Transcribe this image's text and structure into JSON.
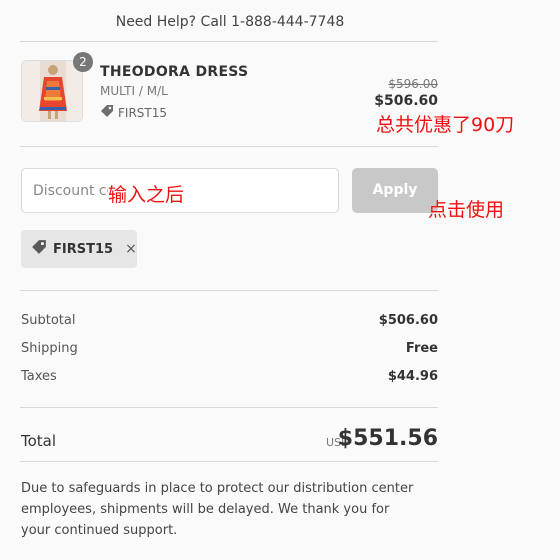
{
  "header": {
    "help_text": "Need Help? Call 1-888-444-7748"
  },
  "item": {
    "quantity": "2",
    "name": "THEODORA DRESS",
    "variant": "MULTI / M/L",
    "discount_code": "FIRST15",
    "original_price": "$596.00",
    "price": "$506.60"
  },
  "discount": {
    "placeholder": "Discount code",
    "apply_label": "Apply",
    "applied_code": "FIRST15",
    "remove_icon": "×"
  },
  "summary": {
    "subtotal_label": "Subtotal",
    "subtotal_value": "$506.60",
    "shipping_label": "Shipping",
    "shipping_value": "Free",
    "taxes_label": "Taxes",
    "taxes_value": "$44.96",
    "total_label": "Total",
    "currency": "USD",
    "total_value": "$551.56"
  },
  "notice": "Due to safeguards in place to protect our distribution center employees, shipments will be delayed. We thank you for your continued support.",
  "annotations": {
    "saved": "总共优惠了90刀",
    "after_input": "输入之后",
    "click_apply": "点击使用"
  }
}
